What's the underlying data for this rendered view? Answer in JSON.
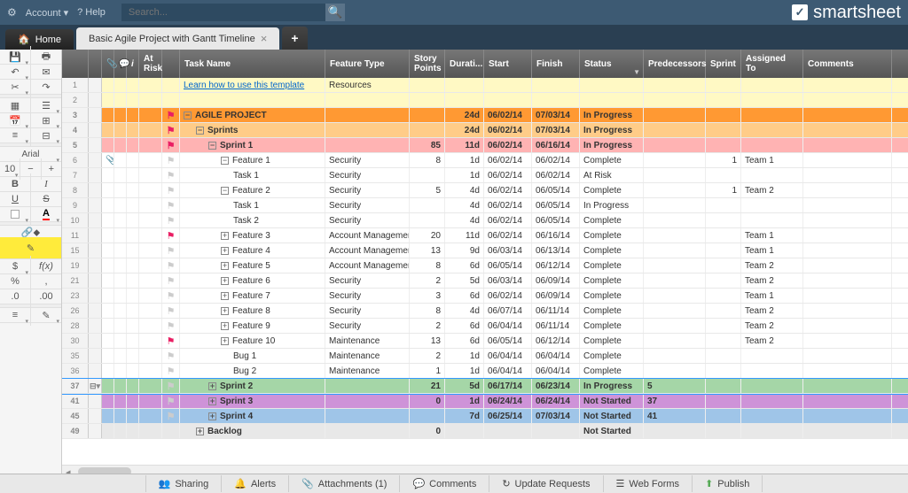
{
  "topbar": {
    "account": "Account",
    "help": "Help",
    "search_placeholder": "Search...",
    "brand": "smartsheet"
  },
  "tabs": {
    "home": "Home",
    "sheet": "Basic Agile Project with Gantt Timeline"
  },
  "lefttools": {
    "font": "Arial",
    "size": "10"
  },
  "columns": [
    "At Risk",
    "Task Name",
    "Feature Type",
    "Story Points",
    "Durati...",
    "Start",
    "Finish",
    "Status",
    "Predecessors",
    "Sprint",
    "Assigned To",
    "Comments"
  ],
  "rows": [
    {
      "n": 1,
      "bg": "bg-yellow",
      "indent": 0,
      "task": "Learn how to use this template",
      "link": true,
      "feat": "Resources"
    },
    {
      "n": 2,
      "bg": "bg-yellow"
    },
    {
      "n": 3,
      "bg": "bg-orange",
      "indent": 0,
      "exp": "-",
      "flag": "pink",
      "task": "AGILE PROJECT",
      "dur": "24d",
      "start": "06/02/14",
      "fin": "07/03/14",
      "stat": "In Progress"
    },
    {
      "n": 4,
      "bg": "bg-peach",
      "indent": 1,
      "exp": "-",
      "flag": "pink",
      "task": "Sprints",
      "dur": "24d",
      "start": "06/02/14",
      "fin": "07/03/14",
      "stat": "In Progress"
    },
    {
      "n": 5,
      "bg": "bg-pink",
      "indent": 2,
      "exp": "-",
      "flag": "pink",
      "task": "Sprint 1",
      "pts": "85",
      "dur": "11d",
      "start": "06/02/14",
      "fin": "06/16/14",
      "stat": "In Progress"
    },
    {
      "n": 6,
      "indent": 3,
      "exp": "-",
      "flag": "grey",
      "clip": true,
      "task": "Feature 1",
      "feat": "Security",
      "pts": "8",
      "dur": "1d",
      "start": "06/02/14",
      "fin": "06/02/14",
      "stat": "Complete",
      "sprint": "1",
      "assn": "Team 1"
    },
    {
      "n": 7,
      "indent": 4,
      "flag": "grey",
      "task": "Task 1",
      "feat": "Security",
      "dur": "1d",
      "start": "06/02/14",
      "fin": "06/02/14",
      "stat": "At Risk"
    },
    {
      "n": 8,
      "indent": 3,
      "exp": "-",
      "flag": "grey",
      "task": "Feature 2",
      "feat": "Security",
      "pts": "5",
      "dur": "4d",
      "start": "06/02/14",
      "fin": "06/05/14",
      "stat": "Complete",
      "sprint": "1",
      "assn": "Team 2"
    },
    {
      "n": 9,
      "indent": 4,
      "flag": "grey",
      "task": "Task 1",
      "feat": "Security",
      "dur": "4d",
      "start": "06/02/14",
      "fin": "06/05/14",
      "stat": "In Progress"
    },
    {
      "n": 10,
      "indent": 4,
      "flag": "grey",
      "task": "Task 2",
      "feat": "Security",
      "dur": "4d",
      "start": "06/02/14",
      "fin": "06/05/14",
      "stat": "Complete"
    },
    {
      "n": 11,
      "indent": 3,
      "exp": "+",
      "flag": "pink",
      "task": "Feature 3",
      "feat": "Account Managemen",
      "pts": "20",
      "dur": "11d",
      "start": "06/02/14",
      "fin": "06/16/14",
      "stat": "Complete",
      "assn": "Team 1"
    },
    {
      "n": 15,
      "indent": 3,
      "exp": "+",
      "flag": "grey",
      "task": "Feature 4",
      "feat": "Account Managemen",
      "pts": "13",
      "dur": "9d",
      "start": "06/03/14",
      "fin": "06/13/14",
      "stat": "Complete",
      "assn": "Team 1"
    },
    {
      "n": 19,
      "indent": 3,
      "exp": "+",
      "flag": "grey",
      "task": "Feature 5",
      "feat": "Account Managemen",
      "pts": "8",
      "dur": "6d",
      "start": "06/05/14",
      "fin": "06/12/14",
      "stat": "Complete",
      "assn": "Team 2"
    },
    {
      "n": 21,
      "indent": 3,
      "exp": "+",
      "flag": "grey",
      "task": "Feature 6",
      "feat": "Security",
      "pts": "2",
      "dur": "5d",
      "start": "06/03/14",
      "fin": "06/09/14",
      "stat": "Complete",
      "assn": "Team 2"
    },
    {
      "n": 23,
      "indent": 3,
      "exp": "+",
      "flag": "grey",
      "task": "Feature 7",
      "feat": "Security",
      "pts": "3",
      "dur": "6d",
      "start": "06/02/14",
      "fin": "06/09/14",
      "stat": "Complete",
      "assn": "Team 1"
    },
    {
      "n": 26,
      "indent": 3,
      "exp": "+",
      "flag": "grey",
      "task": "Feature 8",
      "feat": "Security",
      "pts": "8",
      "dur": "4d",
      "start": "06/07/14",
      "fin": "06/11/14",
      "stat": "Complete",
      "assn": "Team 2"
    },
    {
      "n": 28,
      "indent": 3,
      "exp": "+",
      "flag": "grey",
      "task": "Feature 9",
      "feat": "Security",
      "pts": "2",
      "dur": "6d",
      "start": "06/04/14",
      "fin": "06/11/14",
      "stat": "Complete",
      "assn": "Team 2"
    },
    {
      "n": 30,
      "indent": 3,
      "exp": "+",
      "flag": "pink",
      "task": "Feature 10",
      "feat": "Maintenance",
      "pts": "13",
      "dur": "6d",
      "start": "06/05/14",
      "fin": "06/12/14",
      "stat": "Complete",
      "assn": "Team 2"
    },
    {
      "n": 35,
      "indent": 4,
      "flag": "grey",
      "task": "Bug 1",
      "feat": "Maintenance",
      "pts": "2",
      "dur": "1d",
      "start": "06/04/14",
      "fin": "06/04/14",
      "stat": "Complete"
    },
    {
      "n": 36,
      "indent": 4,
      "flag": "grey",
      "task": "Bug 2",
      "feat": "Maintenance",
      "pts": "1",
      "dur": "1d",
      "start": "06/04/14",
      "fin": "06/04/14",
      "stat": "Complete"
    },
    {
      "n": 37,
      "bg": "bg-green",
      "indent": 2,
      "exp": "+",
      "flag": "grey",
      "task": "Sprint 2",
      "pts": "21",
      "dur": "5d",
      "start": "06/17/14",
      "fin": "06/23/14",
      "stat": "In Progress",
      "pred": "5",
      "selected": true
    },
    {
      "n": 41,
      "bg": "bg-purple",
      "indent": 2,
      "exp": "+",
      "flag": "grey",
      "task": "Sprint 3",
      "pts": "0",
      "dur": "1d",
      "start": "06/24/14",
      "fin": "06/24/14",
      "stat": "Not Started",
      "pred": "37"
    },
    {
      "n": 45,
      "bg": "bg-blue",
      "indent": 2,
      "exp": "+",
      "flag": "grey",
      "task": "Sprint 4",
      "pts": "",
      "dur": "7d",
      "start": "06/25/14",
      "fin": "07/03/14",
      "stat": "Not Started",
      "pred": "41"
    },
    {
      "n": 49,
      "bg": "bg-grey",
      "indent": 1,
      "exp": "+",
      "task": "Backlog",
      "pts": "0",
      "stat": "Not Started"
    }
  ],
  "bottombar": {
    "sharing": "Sharing",
    "alerts": "Alerts",
    "attachments": "Attachments (1)",
    "comments": "Comments",
    "update": "Update Requests",
    "webforms": "Web Forms",
    "publish": "Publish"
  }
}
